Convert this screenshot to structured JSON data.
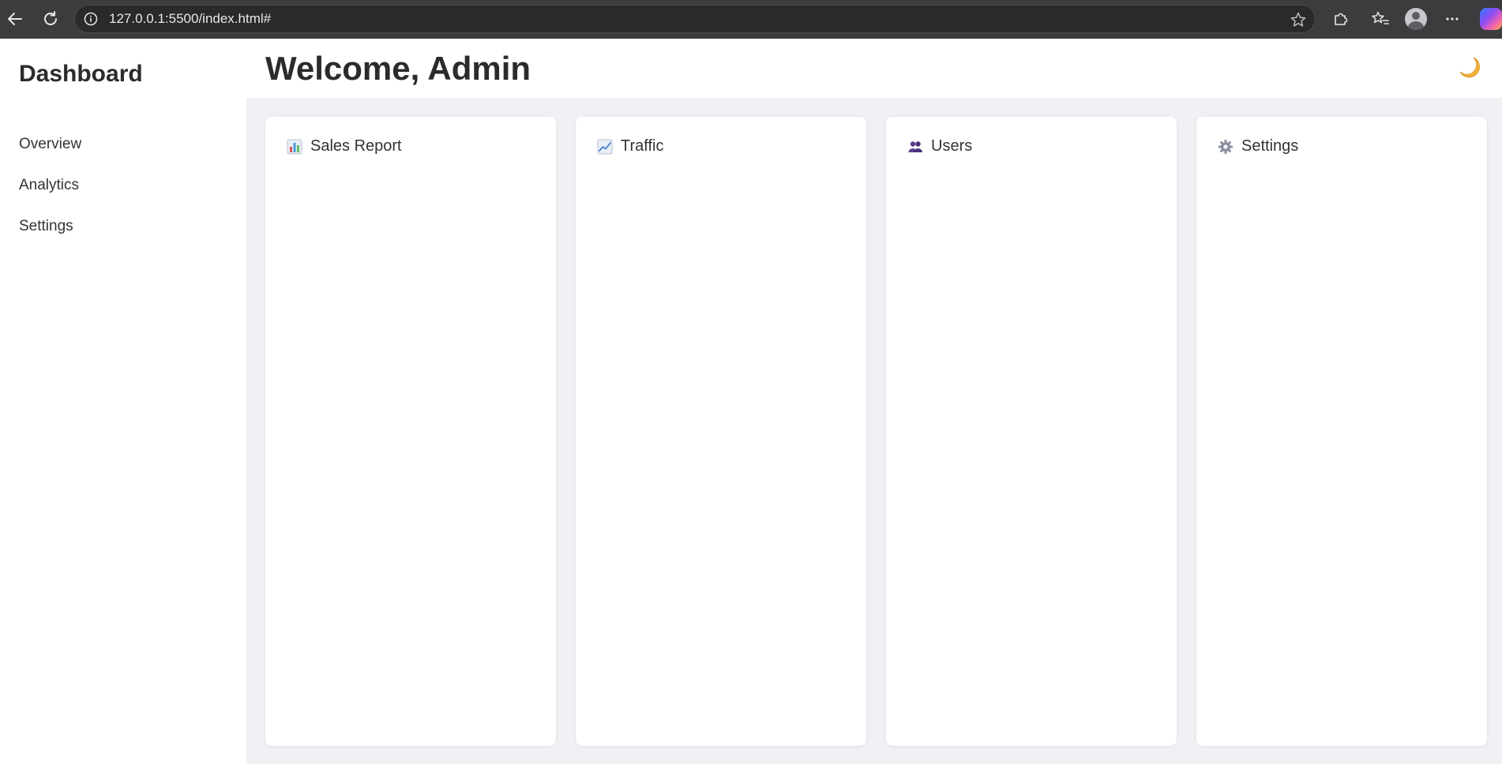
{
  "browser": {
    "url": "127.0.0.1:5500/index.html#"
  },
  "sidebar": {
    "brand": "Dashboard",
    "links": [
      {
        "label": "Overview"
      },
      {
        "label": "Analytics"
      },
      {
        "label": "Settings"
      }
    ]
  },
  "header": {
    "welcome": "Welcome, Admin",
    "theme_icon": "moon-icon"
  },
  "cards": [
    {
      "title": "Sales Report",
      "icon": "bar-chart-icon"
    },
    {
      "title": "Traffic",
      "icon": "line-chart-icon"
    },
    {
      "title": "Users",
      "icon": "users-icon"
    },
    {
      "title": "Settings",
      "icon": "gear-icon"
    }
  ],
  "colors": {
    "chrome_bg": "#3c3c3f",
    "content_bg": "#f0f1f4",
    "card_bg": "#ffffff",
    "text": "#2b2b2b"
  }
}
